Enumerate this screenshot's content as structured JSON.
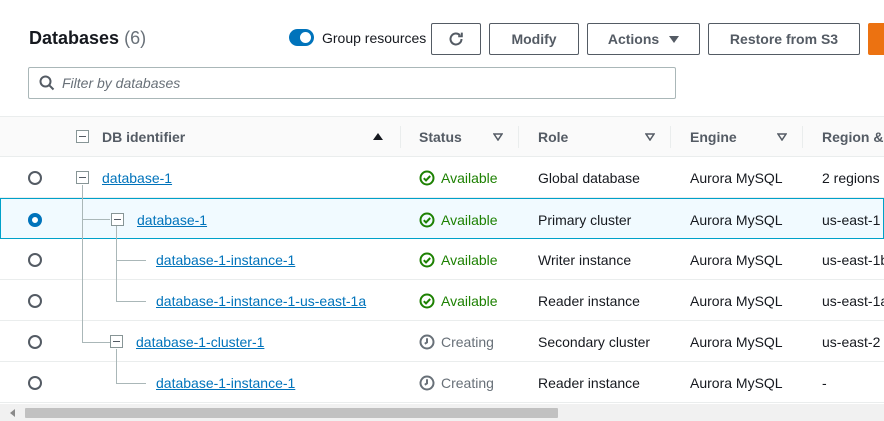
{
  "header": {
    "title": "Databases",
    "count": "(6)",
    "group_toggle_label": "Group resources",
    "buttons": {
      "modify": "Modify",
      "actions": "Actions",
      "restore": "Restore from S3"
    }
  },
  "search": {
    "placeholder": "Filter by databases",
    "value": ""
  },
  "columns": {
    "db_identifier": "DB identifier",
    "status": "Status",
    "role": "Role",
    "engine": "Engine",
    "region": "Region &"
  },
  "rows": [
    {
      "id": "database-1",
      "status": "Available",
      "status_kind": "ok",
      "role": "Global database",
      "engine": "Aurora MySQL",
      "region": "2 regions",
      "selected": false,
      "level": 0
    },
    {
      "id": "database-1",
      "status": "Available",
      "status_kind": "ok",
      "role": "Primary cluster",
      "engine": "Aurora MySQL",
      "region": "us-east-1",
      "selected": true,
      "level": 1
    },
    {
      "id": "database-1-instance-1",
      "status": "Available",
      "status_kind": "ok",
      "role": "Writer instance",
      "engine": "Aurora MySQL",
      "region": "us-east-1b",
      "selected": false,
      "level": 2
    },
    {
      "id": "database-1-instance-1-us-east-1a",
      "status": "Available",
      "status_kind": "ok",
      "role": "Reader instance",
      "engine": "Aurora MySQL",
      "region": "us-east-1a",
      "selected": false,
      "level": 2
    },
    {
      "id": "database-1-cluster-1",
      "status": "Creating",
      "status_kind": "pending",
      "role": "Secondary cluster",
      "engine": "Aurora MySQL",
      "region": "us-east-2",
      "selected": false,
      "level": 1
    },
    {
      "id": "database-1-instance-1",
      "status": "Creating",
      "status_kind": "pending",
      "role": "Reader instance",
      "engine": "Aurora MySQL",
      "region": "-",
      "selected": false,
      "level": 2
    }
  ],
  "colors": {
    "accent": "#0073bb",
    "ok": "#1d8102",
    "pending": "#687078",
    "primary_button": "#ec7211"
  },
  "icons": {
    "search": "search-icon",
    "refresh": "refresh-icon",
    "sort": "sort-icon",
    "status_ok": "check-circle-icon",
    "status_pending": "clock-icon"
  }
}
